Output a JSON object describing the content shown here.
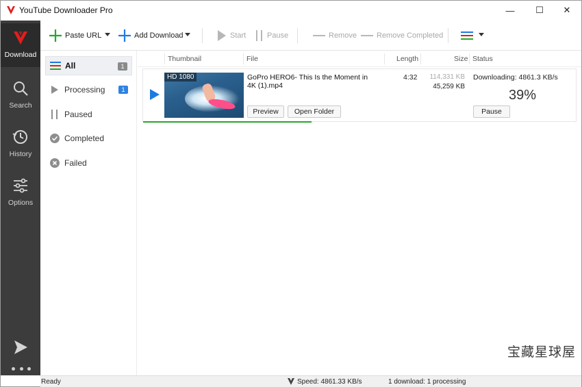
{
  "window": {
    "title": "YouTube Downloader Pro",
    "controls": {
      "minimize": "—",
      "maximize": "☐",
      "close": "✕"
    }
  },
  "rail": {
    "items": [
      {
        "label": "Download",
        "icon": "download-logo-icon",
        "active": true
      },
      {
        "label": "Search",
        "icon": "search-icon"
      },
      {
        "label": "History",
        "icon": "history-icon"
      },
      {
        "label": "Options",
        "icon": "options-sliders-icon"
      }
    ]
  },
  "toolbar": {
    "paste_url": "Paste URL",
    "add_download": "Add Download",
    "start": "Start",
    "pause": "Pause",
    "remove": "Remove",
    "remove_completed": "Remove Completed"
  },
  "categories": [
    {
      "label": "All",
      "badge": "1",
      "selected": true
    },
    {
      "label": "Processing",
      "badge": "1"
    },
    {
      "label": "Paused",
      "badge": ""
    },
    {
      "label": "Completed",
      "badge": ""
    },
    {
      "label": "Failed",
      "badge": ""
    }
  ],
  "columns": {
    "thumbnail": "Thumbnail",
    "file": "File",
    "length": "Length",
    "size": "Size",
    "status": "Status"
  },
  "download": {
    "quality_tag": "HD 1080",
    "file_name": "GoPro HERO6- This Is the Moment in 4K (1).mp4",
    "preview": "Preview",
    "open_folder": "Open Folder",
    "length": "4:32",
    "size_total": "114,331 KB",
    "size_done": "45,259 KB",
    "status": "Downloading: 4861.3 KB/s",
    "percent": "39%",
    "progress": 0.39,
    "pause": "Pause"
  },
  "statusbar": {
    "ready": "Ready",
    "speed": "Speed: 4861.33 KB/s",
    "count": "1 download: 1 processing"
  },
  "watermark": "宝藏星球屋",
  "colors": {
    "accent_red": "#e01e1e",
    "progress_green": "#2aa32a",
    "badge_blue": "#2e82e0",
    "play_blue": "#1d7be0"
  }
}
